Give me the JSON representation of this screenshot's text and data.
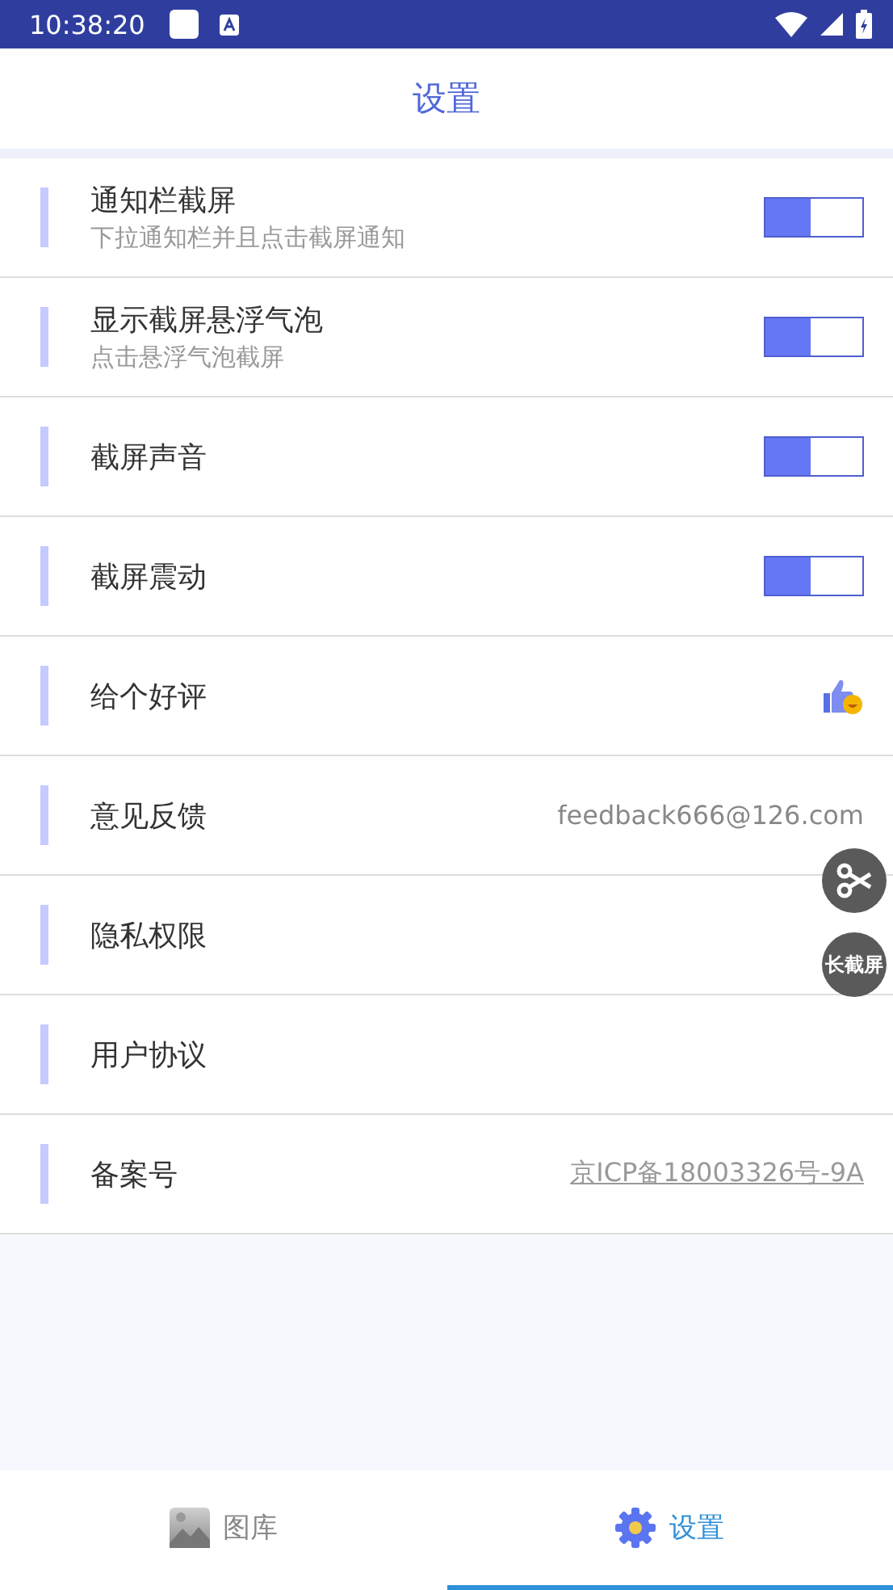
{
  "status_bar": {
    "time": "10:38:20"
  },
  "header": {
    "title": "设置"
  },
  "settings": [
    {
      "kind": "toggle",
      "label": "通知栏截屏",
      "description": "下拉通知栏并且点击截屏通知",
      "on": true
    },
    {
      "kind": "toggle",
      "label": "显示截屏悬浮气泡",
      "description": "点击悬浮气泡截屏",
      "on": true
    },
    {
      "kind": "toggle",
      "label": "截屏声音",
      "on": true
    },
    {
      "kind": "toggle",
      "label": "截屏震动",
      "on": true
    },
    {
      "kind": "icon",
      "label": "给个好评"
    },
    {
      "kind": "value",
      "label": "意见反馈",
      "value": "feedback666@126.com"
    },
    {
      "kind": "plain",
      "label": "隐私权限"
    },
    {
      "kind": "plain",
      "label": "用户协议"
    },
    {
      "kind": "link",
      "label": "备案号",
      "value": "京ICP备18003326号-9A"
    }
  ],
  "floating_buttons": [
    {
      "kind": "scissors"
    },
    {
      "kind": "text",
      "label": "长截屏"
    }
  ],
  "bottom_nav": [
    {
      "kind": "gallery",
      "label": "图库",
      "selected": false
    },
    {
      "kind": "settings",
      "label": "设置",
      "selected": true
    }
  ]
}
